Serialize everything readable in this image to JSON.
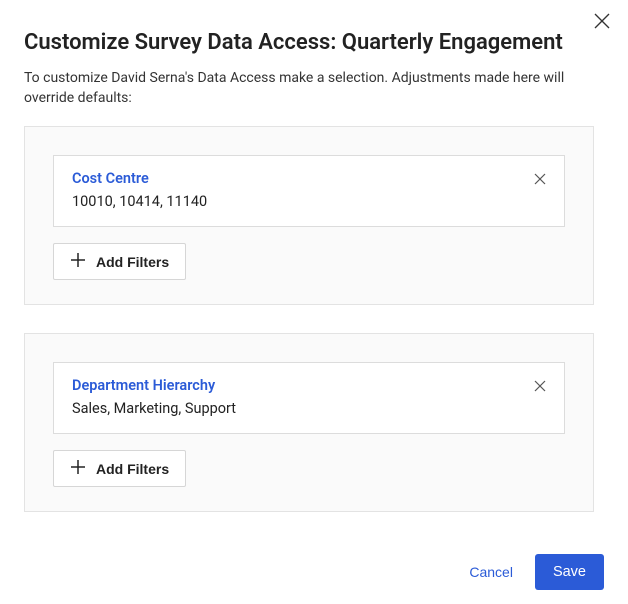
{
  "title": "Customize Survey Data Access: Quarterly Engagement",
  "subtitle": "To customize David Serna's Data Access make a selection. Adjustments made here will override defaults:",
  "sections": [
    {
      "filter_label": "Cost Centre",
      "filter_values": "10010, 10414, 11140",
      "add_label": "Add Filters"
    },
    {
      "filter_label": "Department Hierarchy",
      "filter_values": "Sales, Marketing, Support",
      "add_label": "Add Filters"
    }
  ],
  "footer": {
    "cancel": "Cancel",
    "save": "Save"
  }
}
